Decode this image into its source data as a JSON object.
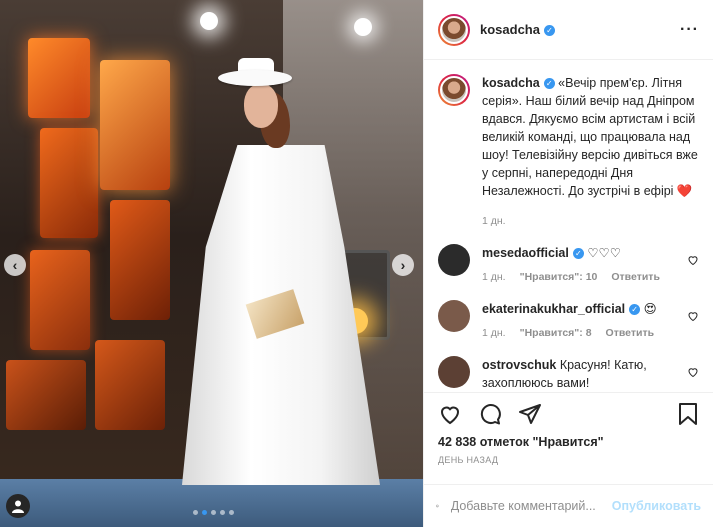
{
  "post": {
    "username": "kosadcha",
    "caption": "«Вечір прем'єр. Літня серія». Наш білий вечір над Дніпром вдався. Дякуємо всім артистам і всій великій команді, що працювала над шоу! Телевізійну версію дивіться вже у серпні, напередодні Дня Незалежності. До зустрічі в ефірі ❤️",
    "caption_time": "1 дн.",
    "likes_text": "42 838 отметок \"Нравится\"",
    "posted_ago": "День назад",
    "photo_dots": 5,
    "photo_active_dot": 2
  },
  "comments": [
    {
      "username": "mesedaofficial",
      "text": "♡♡♡",
      "time": "1 дн.",
      "likes": "\"Нравится\": 10",
      "reply": "Ответить",
      "avatar_color": "#2b2b2b"
    },
    {
      "username": "ekaterinakukhar_official",
      "text": "😍",
      "time": "1 дн.",
      "likes": "\"Нравится\": 8",
      "reply": "Ответить",
      "avatar_color": "#7a5a4a"
    },
    {
      "username": "ostrovschuk",
      "text": "Красуня! Катю, захоплююсь вами!",
      "time": "",
      "likes": "",
      "reply": "",
      "avatar_color": "#5c4034"
    }
  ],
  "add_comment": {
    "placeholder": "Добавьте комментарий...",
    "publish_label": "Опубликовать"
  },
  "icons": {
    "like": "heart-icon",
    "comment": "comment-icon",
    "share": "share-icon",
    "save": "bookmark-icon",
    "emoji": "smile-icon"
  },
  "colors": {
    "verified": "#3897f0",
    "muted": "#8e8e8e",
    "publish_disabled": "#b2dffc"
  }
}
